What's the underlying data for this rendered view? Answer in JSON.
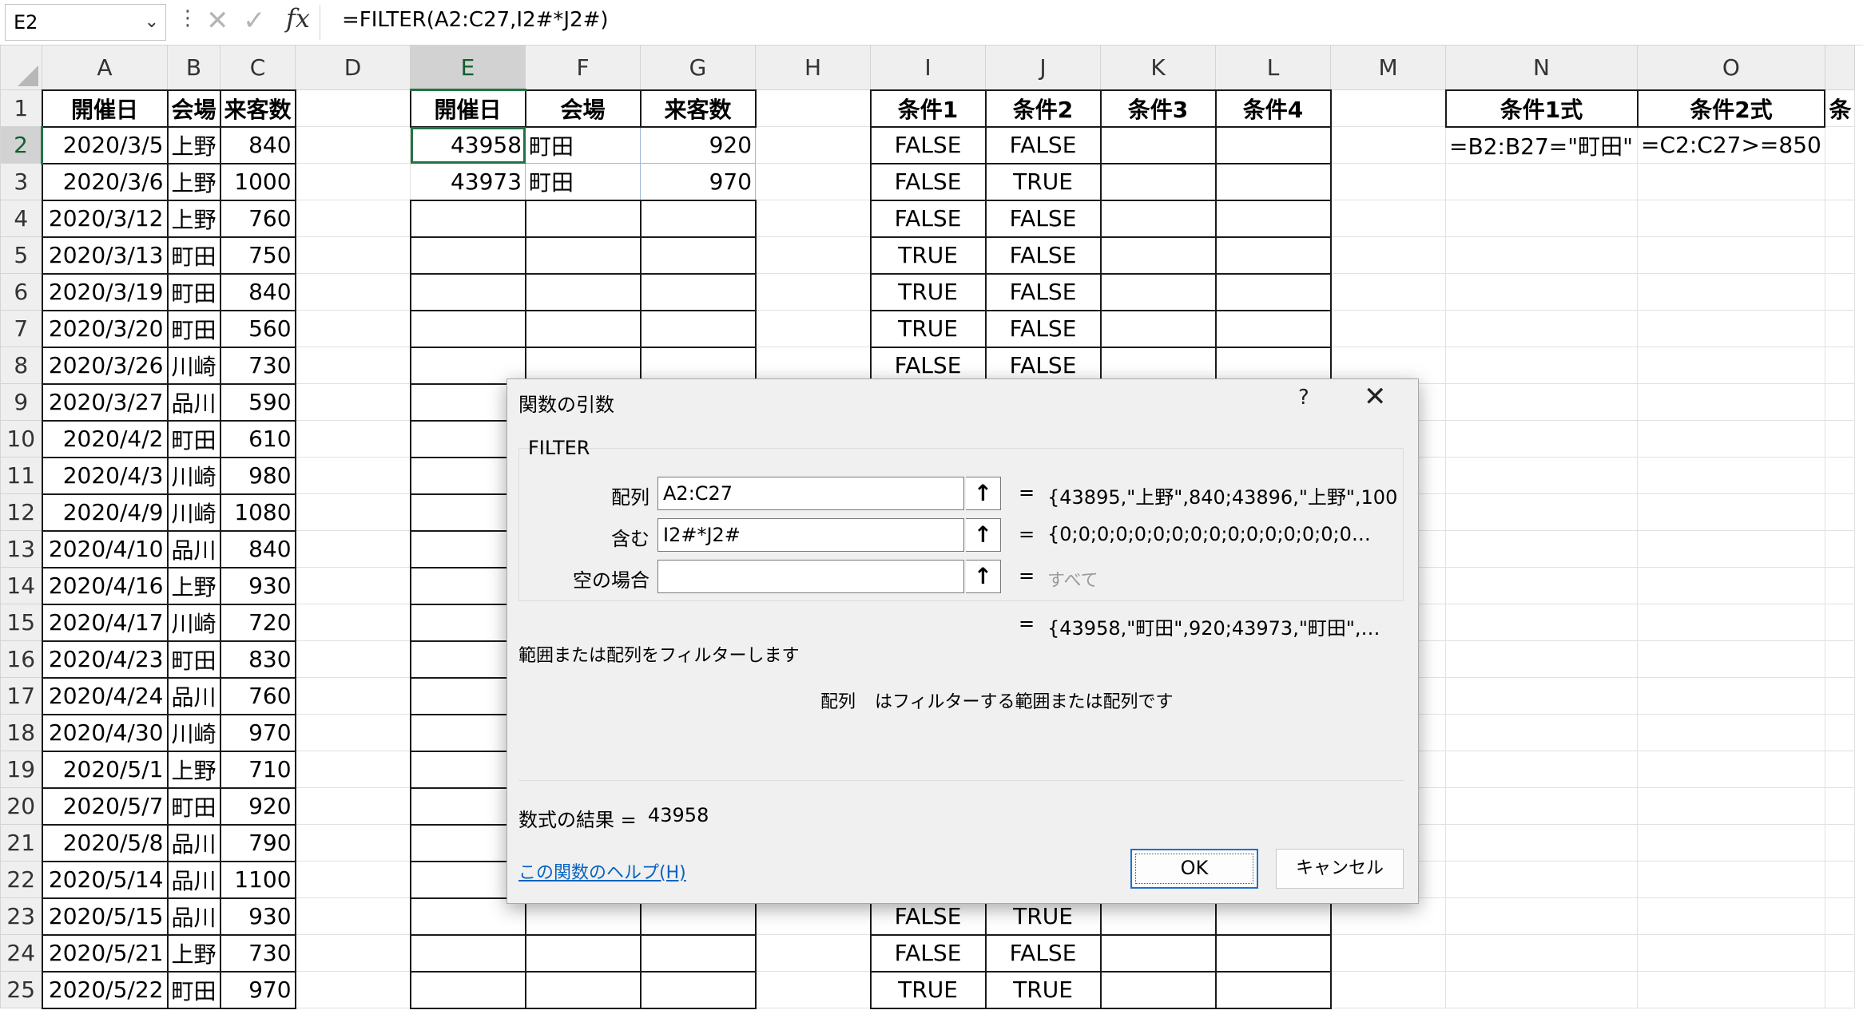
{
  "formula_bar": {
    "name_box": "E2",
    "formula": "=FILTER(A2:C27,I2#*J2#)",
    "cancel_icon": "✕",
    "enter_icon": "✓",
    "fx_icon": "fx"
  },
  "columns": [
    "A",
    "B",
    "C",
    "D",
    "E",
    "F",
    "G",
    "H",
    "I",
    "J",
    "K",
    "L",
    "M",
    "N",
    "O",
    ""
  ],
  "rows": [
    {
      "n": "1",
      "a": "開催日",
      "b": "会場",
      "c": "来客数",
      "e": "開催日",
      "f": "会場",
      "g": "来客数",
      "i": "条件1",
      "j": "条件2",
      "k": "条件3",
      "l": "条件4",
      "nn": "条件1式",
      "o": "条件2式",
      "p": "条"
    },
    {
      "n": "2",
      "a": "2020/3/5",
      "b": "上野",
      "c": "840",
      "e": "43958",
      "f": "町田",
      "g": "920",
      "i": "FALSE",
      "j": "FALSE",
      "nn": "=B2:B27=\"町田\"",
      "o": "=C2:C27>=850"
    },
    {
      "n": "3",
      "a": "2020/3/6",
      "b": "上野",
      "c": "1000",
      "e": "43973",
      "f": "町田",
      "g": "970",
      "i": "FALSE",
      "j": "TRUE"
    },
    {
      "n": "4",
      "a": "2020/3/12",
      "b": "上野",
      "c": "760",
      "i": "FALSE",
      "j": "FALSE"
    },
    {
      "n": "5",
      "a": "2020/3/13",
      "b": "町田",
      "c": "750",
      "i": "TRUE",
      "j": "FALSE"
    },
    {
      "n": "6",
      "a": "2020/3/19",
      "b": "町田",
      "c": "840",
      "i": "TRUE",
      "j": "FALSE"
    },
    {
      "n": "7",
      "a": "2020/3/20",
      "b": "町田",
      "c": "560",
      "i": "TRUE",
      "j": "FALSE"
    },
    {
      "n": "8",
      "a": "2020/3/26",
      "b": "川崎",
      "c": "730",
      "i": "FALSE",
      "j": "FALSE"
    },
    {
      "n": "9",
      "a": "2020/3/27",
      "b": "品川",
      "c": "590"
    },
    {
      "n": "10",
      "a": "2020/4/2",
      "b": "町田",
      "c": "610"
    },
    {
      "n": "11",
      "a": "2020/4/3",
      "b": "川崎",
      "c": "980"
    },
    {
      "n": "12",
      "a": "2020/4/9",
      "b": "川崎",
      "c": "1080"
    },
    {
      "n": "13",
      "a": "2020/4/10",
      "b": "品川",
      "c": "840"
    },
    {
      "n": "14",
      "a": "2020/4/16",
      "b": "上野",
      "c": "930"
    },
    {
      "n": "15",
      "a": "2020/4/17",
      "b": "川崎",
      "c": "720"
    },
    {
      "n": "16",
      "a": "2020/4/23",
      "b": "町田",
      "c": "830"
    },
    {
      "n": "17",
      "a": "2020/4/24",
      "b": "品川",
      "c": "760"
    },
    {
      "n": "18",
      "a": "2020/4/30",
      "b": "川崎",
      "c": "970"
    },
    {
      "n": "19",
      "a": "2020/5/1",
      "b": "上野",
      "c": "710"
    },
    {
      "n": "20",
      "a": "2020/5/7",
      "b": "町田",
      "c": "920"
    },
    {
      "n": "21",
      "a": "2020/5/8",
      "b": "品川",
      "c": "790"
    },
    {
      "n": "22",
      "a": "2020/5/14",
      "b": "品川",
      "c": "1100"
    },
    {
      "n": "23",
      "a": "2020/5/15",
      "b": "品川",
      "c": "930",
      "i": "FALSE",
      "j": "TRUE"
    },
    {
      "n": "24",
      "a": "2020/5/21",
      "b": "上野",
      "c": "730",
      "i": "FALSE",
      "j": "FALSE"
    },
    {
      "n": "25",
      "a": "2020/5/22",
      "b": "町田",
      "c": "970",
      "i": "TRUE",
      "j": "TRUE"
    }
  ],
  "dialog": {
    "title": "関数の引数",
    "help_button": "?",
    "close_icon": "✕",
    "function_name": "FILTER",
    "args": [
      {
        "label": "配列",
        "value": "A2:C27",
        "result": "{43895,\"上野\",840;43896,\"上野\",100"
      },
      {
        "label": "含む",
        "value": "I2#*J2#",
        "result": "{0;0;0;0;0;0;0;0;0;0;0;0;0;0;0;0…"
      },
      {
        "label": "空の場合",
        "value": "",
        "result": "すべて"
      }
    ],
    "arg_button_icon": "↑",
    "equals": "=",
    "overall_result": "{43958,\"町田\",920;43973,\"町田\",…",
    "description": "範囲または配列をフィルターします",
    "arg_desc_name": "配列",
    "arg_desc": "はフィルターする範囲または配列です",
    "formula_result_label": "数式の結果 =",
    "formula_result_value": "43958",
    "help_link": "この関数のヘルプ(H)",
    "ok": "OK",
    "cancel": "キャンセル"
  }
}
